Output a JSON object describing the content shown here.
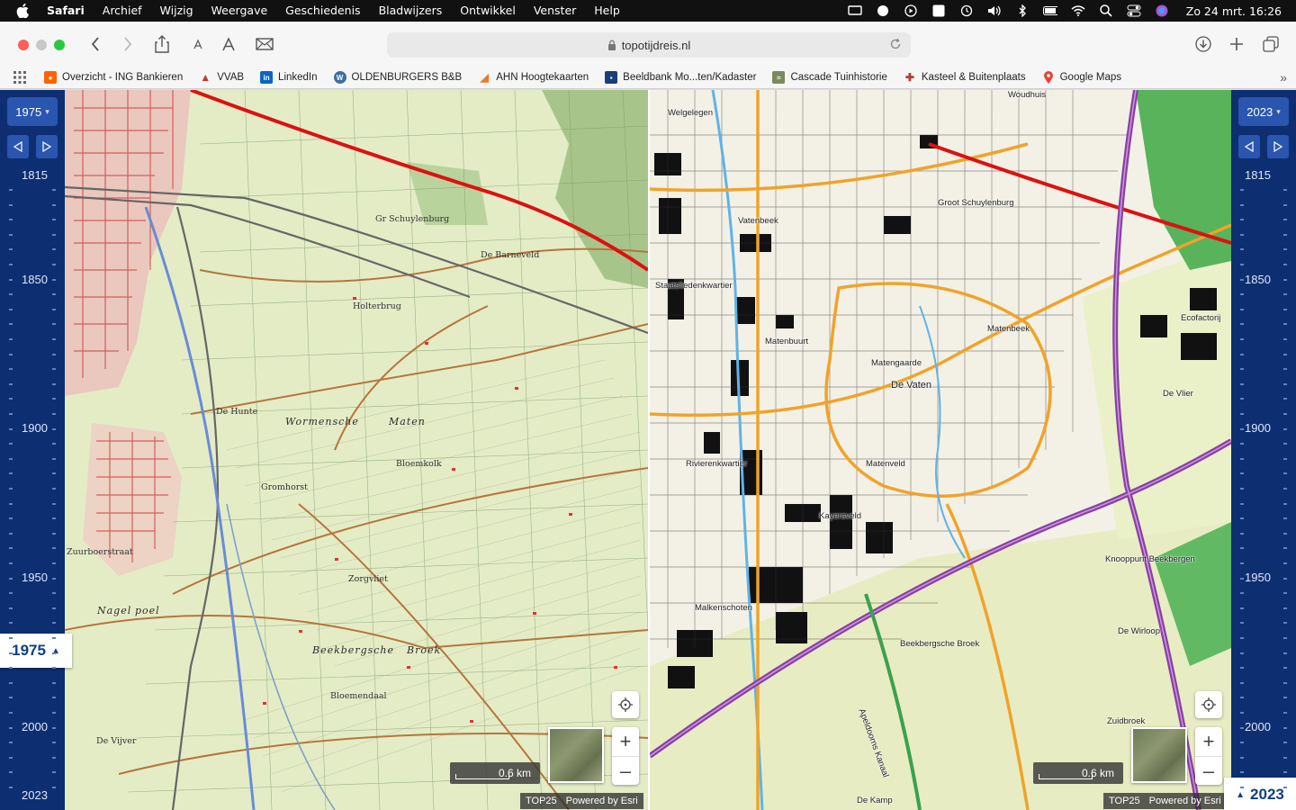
{
  "menubar": {
    "app": "Safari",
    "items": [
      "Archief",
      "Wijzig",
      "Weergave",
      "Geschiedenis",
      "Bladwijzers",
      "Ontwikkel",
      "Venster",
      "Help"
    ],
    "clock": "Zo 24 mrt. 16:26"
  },
  "browser": {
    "url": "topotijdreis.nl",
    "bookmarks": [
      {
        "label": "Overzicht - ING Bankieren",
        "color": "#ff6200",
        "icon": "ing-icon"
      },
      {
        "label": "VVAB",
        "color": "#c0392b",
        "icon": "vvab-icon"
      },
      {
        "label": "LinkedIn",
        "color": "#0a66c2",
        "icon": "linkedin-icon"
      },
      {
        "label": "OLDENBURGERS B&B",
        "color": "#3b6ea5",
        "icon": "wordpress-icon"
      },
      {
        "label": "AHN Hoogtekaarten",
        "color": "#e67e22",
        "icon": "ahn-icon"
      },
      {
        "label": "Beeldbank Mo...ten/Kadaster",
        "color": "#1b3d7a",
        "icon": "kadaster-icon"
      },
      {
        "label": "Cascade Tuinhistorie",
        "color": "#7a8b5c",
        "icon": "cascade-icon"
      },
      {
        "label": "Kasteel & Buitenplaats",
        "color": "#c0392b",
        "icon": "kasteel-icon"
      },
      {
        "label": "Google Maps",
        "color": "#34a853",
        "icon": "google-maps-icon"
      }
    ]
  },
  "timeline_left": {
    "selected_year": "1975",
    "badge_year": "1975",
    "ticks": [
      "1815",
      "1850",
      "1900",
      "1950",
      "2000",
      "2023"
    ]
  },
  "timeline_right": {
    "selected_year": "2023",
    "badge_year": "2023",
    "ticks": [
      "1815",
      "1850",
      "1900",
      "1950",
      "2000"
    ]
  },
  "map_left": {
    "scale": "0.6 km",
    "attribution": {
      "source": "TOP25",
      "powered": "Powered by Esri"
    },
    "labels": [
      "Gr Schuylenburg",
      "De Barneveld",
      "Holterbrug",
      "Wormensche",
      "Maten",
      "Gromhorst",
      "Nagel",
      "poel",
      "Beekbergsche",
      "Broek",
      "Zuurboerstraat",
      "De Vijver",
      "Bloemendaal",
      "De Hunte",
      "Zorgvliet",
      "Bloemkolk"
    ]
  },
  "map_right": {
    "scale": "0.6 km",
    "attribution": {
      "source": "TOP25",
      "powered": "Powered by Esri"
    },
    "labels": [
      "Welgelegen",
      "Woudhuis",
      "Groot Schuylenburg",
      "Vatenbeek",
      "Staatsliedenkwartier",
      "Matenbuurt",
      "Matenbeek",
      "Matengaarde",
      "De Vaten",
      "Matenveld",
      "Rivierenkwartier",
      "Kayersveld",
      "Malkenschoten",
      "Beekbergsche Broek",
      "Apeldoorns Kanaal",
      "Knooppunt Beekbergen",
      "Ecofactorij",
      "De Vlier",
      "De Wirloop",
      "Zuidbroek",
      "De Kamp"
    ]
  }
}
